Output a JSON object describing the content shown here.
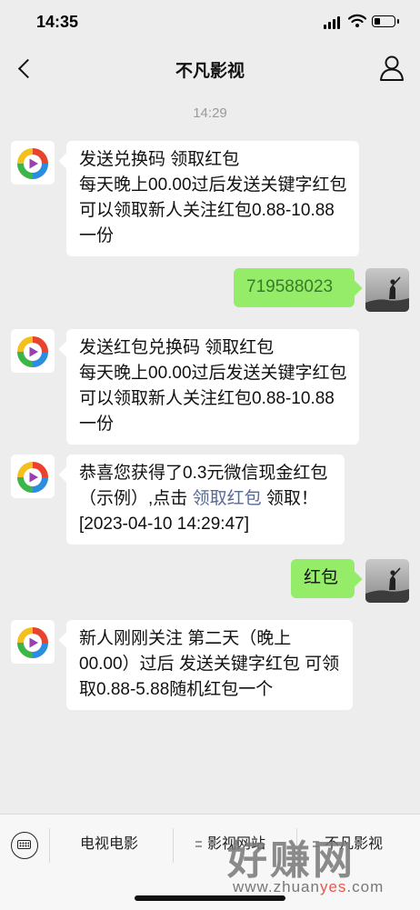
{
  "status_bar": {
    "time": "14:35",
    "battery_level": 0.3
  },
  "nav": {
    "title": "不凡影视"
  },
  "chat": {
    "timestamp": "14:29",
    "messages": [
      {
        "from": "bot",
        "text": "发送兑换码 领取红包\n每天晚上00.00过后发送关键字红包 可以领取新人关注红包0.88-10.88一份"
      },
      {
        "from": "user",
        "text": "719588023"
      },
      {
        "from": "bot",
        "text": "发送红包兑换码 领取红包\n每天晚上00.00过后发送关键字红包 可以领取新人关注红包0.88-10.88一份"
      },
      {
        "from": "bot",
        "text_before": "恭喜您获得了0.3元微信现金红包（示例）,点击 ",
        "link": "领取红包",
        "text_after": " 领取！[2023-04-10 14:29:47]"
      },
      {
        "from": "user",
        "text": "红包"
      },
      {
        "from": "bot",
        "text": "新人刚刚关注 第二天（晚上00.00）过后 发送关键字红包 可领取0.88-5.88随机红包一个"
      }
    ]
  },
  "bottom_menu": {
    "items": [
      {
        "label": "电视电影"
      },
      {
        "label": "影视网站"
      },
      {
        "label": "不凡影视"
      }
    ]
  },
  "watermark": {
    "title": "好赚网",
    "url_a": "www.zhuan",
    "url_b": "yes",
    "url_c": ".com"
  }
}
